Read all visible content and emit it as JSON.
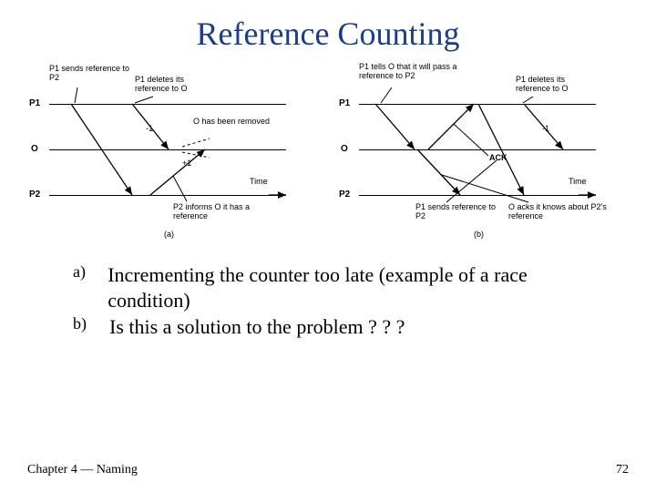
{
  "title": "Reference Counting",
  "diagram": {
    "a": {
      "actors": {
        "p1": "P1",
        "o": "O",
        "p2": "P2"
      },
      "cap1": "P1 sends reference to P2",
      "cap2": "P1 deletes its reference to O",
      "cap3": "O has been removed",
      "minus": "-1",
      "plus": "+1",
      "inform": "P2 informs O it has a reference",
      "time": "Time",
      "label": "(a)"
    },
    "b": {
      "actors": {
        "p1": "P1",
        "o": "O",
        "p2": "P2"
      },
      "cap1": "P1 tells O that it will pass a reference to P2",
      "cap2": "P1 deletes its reference to O",
      "minus": "-1",
      "ack": "ACK",
      "send": "P1 sends reference to P2",
      "oack": "O acks it knows about P2's reference",
      "time": "Time",
      "label": "(b)"
    }
  },
  "bullets": {
    "a_label": "a)",
    "a_text": "Incrementing the counter too late (example of a race condition)",
    "b_label": "b)",
    "b_text": "Is this a solution to the problem ? ? ?"
  },
  "footer": {
    "left": "Chapter 4 — Naming",
    "right": "72"
  }
}
